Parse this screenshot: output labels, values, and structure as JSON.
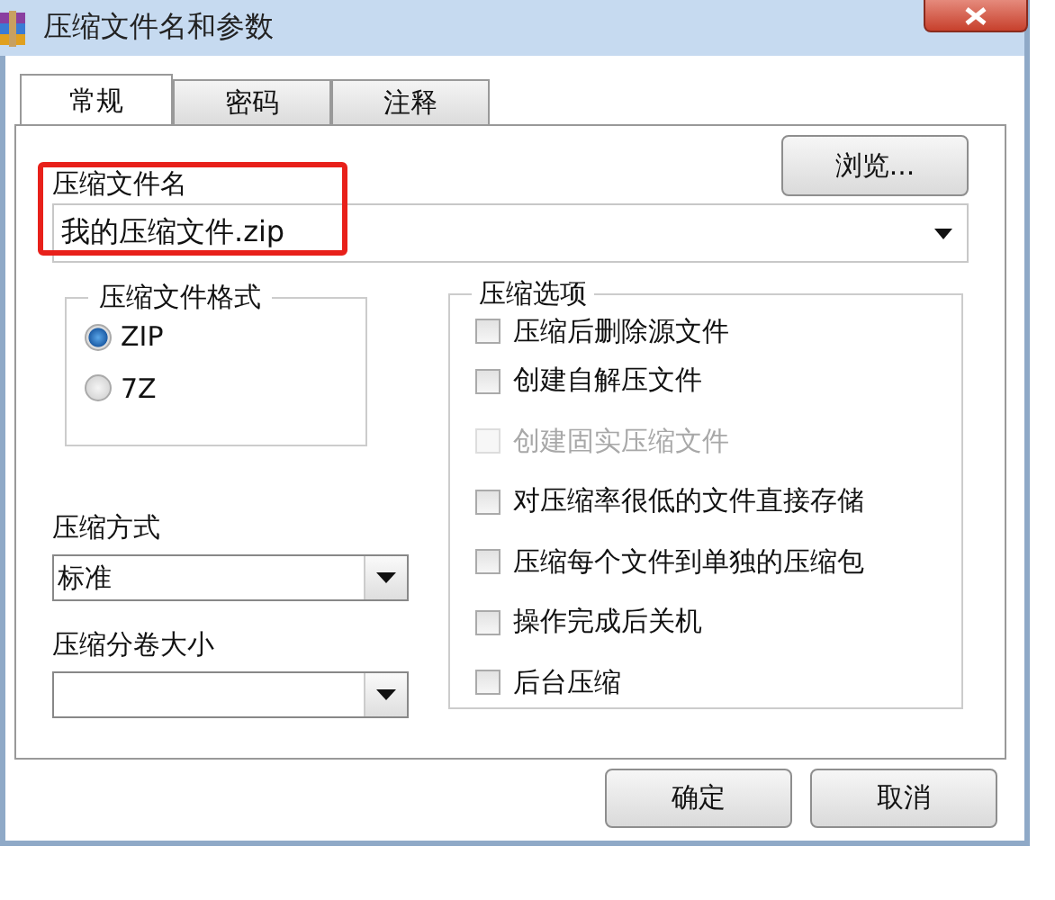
{
  "window": {
    "title": "压缩文件名和参数"
  },
  "tabs": [
    {
      "label": "常规",
      "selected": true
    },
    {
      "label": "密码",
      "selected": false
    },
    {
      "label": "注释",
      "selected": false
    }
  ],
  "archive_name": {
    "label": "压缩文件名",
    "value": "我的压缩文件.zip",
    "highlighted": true
  },
  "browse_button": "浏览...",
  "archive_format": {
    "title": "压缩文件格式",
    "options": [
      {
        "label": "ZIP",
        "selected": true
      },
      {
        "label": "7Z",
        "selected": false
      }
    ]
  },
  "compression_method": {
    "label": "压缩方式",
    "value": "标准"
  },
  "split_size": {
    "label": "压缩分卷大小"
  },
  "options": {
    "title": "压缩选项",
    "items": [
      {
        "label": "压缩后删除源文件",
        "checked": false,
        "disabled": false
      },
      {
        "label": "创建自解压文件",
        "checked": false,
        "disabled": false
      },
      {
        "label": "创建固实压缩文件",
        "checked": false,
        "disabled": true
      },
      {
        "label": "对压缩率很低的文件直接存储",
        "checked": false,
        "disabled": false
      },
      {
        "label": "压缩每个文件到单独的压缩包",
        "checked": false,
        "disabled": false
      },
      {
        "label": "操作完成后关机",
        "checked": false,
        "disabled": false
      },
      {
        "label": "后台压缩",
        "checked": false,
        "disabled": false
      }
    ]
  },
  "buttons": [
    "确定",
    "取消"
  ]
}
